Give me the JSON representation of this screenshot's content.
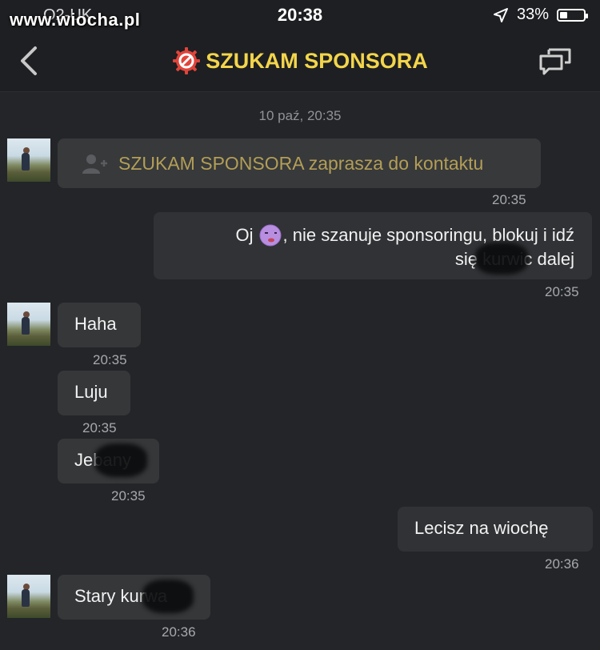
{
  "status_bar": {
    "watermark": "www.wiocha.pl",
    "carrier": "O2-UK",
    "time": "20:38",
    "battery_percent": "33%",
    "battery_level": 0.33
  },
  "header": {
    "title": "SZUKAM SPONSORA",
    "accent_color": "#f3d54b"
  },
  "chat": {
    "date_stamp": "10 paź, 20:35",
    "messages": [
      {
        "side": "left",
        "type": "system",
        "text": "SZUKAM SPONSORA zaprasza do kontaktu",
        "time": "20:35"
      },
      {
        "side": "right",
        "line1_a": "Oj",
        "line1_b": ", nie szanuje sponsoringu, blokuj i idź",
        "line2": "się kurwic dalej",
        "time": "20:35"
      },
      {
        "side": "left",
        "text": "Haha",
        "time": "20:35"
      },
      {
        "side": "left",
        "text": "Luju",
        "time": "20:35"
      },
      {
        "side": "left",
        "text": "Jebany",
        "time": "20:35"
      },
      {
        "side": "right",
        "text": "Lecisz na wiochę",
        "time": "20:36"
      },
      {
        "side": "left",
        "text": "Stary kurwa",
        "time": "20:36"
      }
    ]
  },
  "icons": {
    "back": "chevron-left-icon",
    "title_badge": "prohibited-icon",
    "header_right": "chat-bubbles-icon",
    "system_message": "add-user-icon",
    "emoji": "dizzy-face-emoji"
  }
}
